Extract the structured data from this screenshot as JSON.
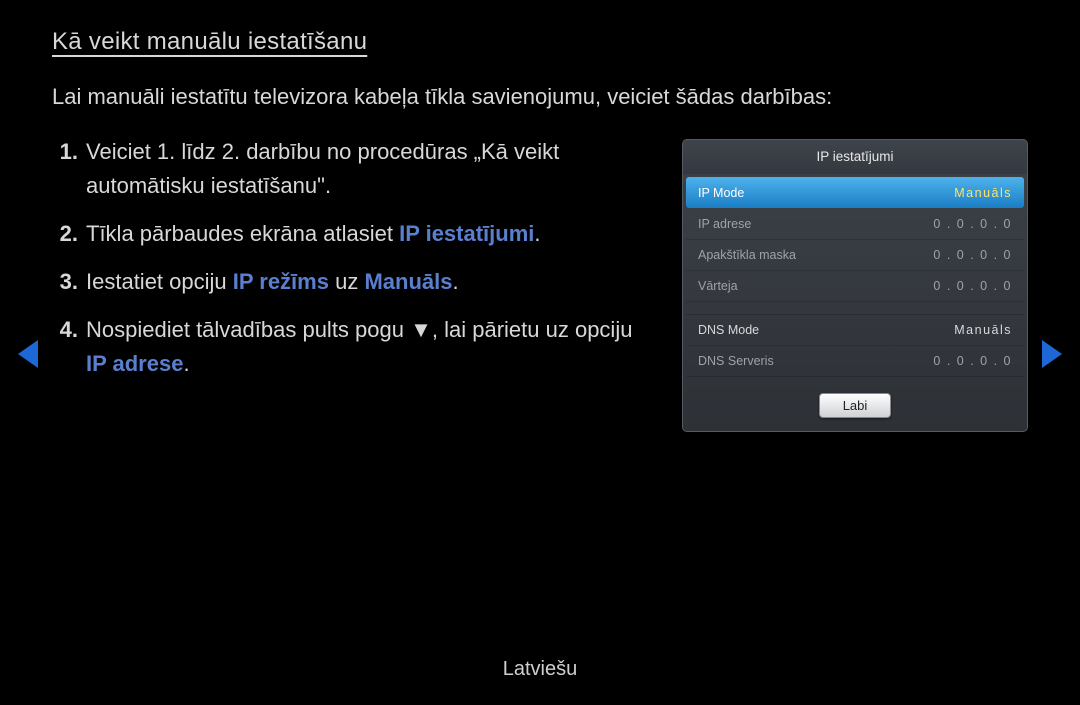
{
  "title": "Kā veikt manuālu iestatīšanu",
  "intro": "Lai manuāli iestatītu televizora kabeļa tīkla savienojumu, veiciet šādas darbības:",
  "steps": {
    "s1": {
      "num": "1.",
      "t1": "Veiciet 1. līdz 2. darbību no procedūras „Kā veikt automātisku iestatīšanu\"."
    },
    "s2": {
      "num": "2.",
      "t1": "Tīkla pārbaudes ekrāna atlasiet ",
      "hl1": "IP iestatījumi",
      "t2": "."
    },
    "s3": {
      "num": "3.",
      "t1": "Iestatiet opciju ",
      "hl1": "IP režīms",
      "t2": " uz ",
      "hl2": "Manuāls",
      "t3": "."
    },
    "s4": {
      "num": "4.",
      "t1": "Nospiediet tālvadības pults pogu ",
      "icon": "▼",
      "t2": ", lai pārietu uz opciju ",
      "hl1": "IP adrese",
      "t3": "."
    }
  },
  "panel": {
    "title": "IP iestatījumi",
    "rows": [
      {
        "label": "IP Mode",
        "value": "Manuāls",
        "selected": true
      },
      {
        "label": "IP adrese",
        "value": "0 . 0 . 0 . 0",
        "selected": false
      },
      {
        "label": "Apakštīkla maska",
        "value": "0 . 0 . 0 . 0",
        "selected": false
      },
      {
        "label": "Vārteja",
        "value": "0 . 0 . 0 . 0",
        "selected": false
      }
    ],
    "rows2": [
      {
        "label": "DNS Mode",
        "value": "Manuāls",
        "light": true
      },
      {
        "label": "DNS Serveris",
        "value": "0 . 0 . 0 . 0",
        "light": false
      }
    ],
    "ok": "Labi"
  },
  "language": "Latviešu"
}
